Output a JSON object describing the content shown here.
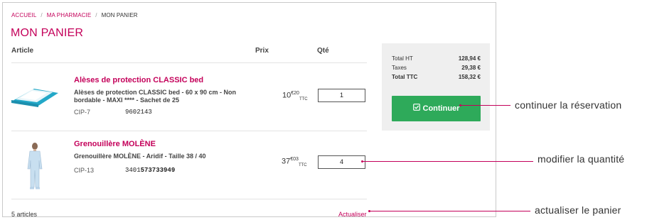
{
  "breadcrumb": {
    "home": "ACCUEIL",
    "section": "MA PHARMACIE",
    "current": "MON PANIER",
    "separator": "/"
  },
  "page": {
    "title": "MON PANIER"
  },
  "table": {
    "col_article": "Article",
    "col_price": "Prix",
    "col_qty": "Qté"
  },
  "items": [
    {
      "name": "Alèses de protection CLASSIC bed",
      "desc": "Alèses de protection CLASSIC bed - 60 x 90 cm - Non bordable - MAXI **** - Sachet de 25",
      "cip_label": "CIP-7",
      "cip_code": "9602143",
      "cip_code_bold": "",
      "price_int": "10",
      "price_dec": "€20",
      "price_suffix": "TTC",
      "qty": "1"
    },
    {
      "name": "Grenouillère MOLÈNE",
      "desc": "Grenouillère MOLÈNE - Aridif - Taille 38 / 40",
      "cip_label": "CIP-13",
      "cip_code": "3401",
      "cip_code_bold": "573733949",
      "price_int": "37",
      "price_dec": "€03",
      "price_suffix": "TTC",
      "qty": "4"
    }
  ],
  "footer": {
    "count": "5 articles",
    "update": "Actualiser"
  },
  "summary": {
    "ht_label": "Total HT",
    "ht_value": "128,94 €",
    "tax_label": "Taxes",
    "tax_value": "29,38 €",
    "ttc_label": "Total TTC",
    "ttc_value": "158,32 €",
    "button_label": "Continuer"
  },
  "callouts": {
    "continue": "continuer la réservation",
    "quantity": "modifier la quantité",
    "update": "actualiser le panier"
  },
  "colors": {
    "accent": "#c4005a",
    "button": "#2eaa5a",
    "summary_bg": "#efefef"
  },
  "icons": {
    "continue": "check-square-icon"
  }
}
